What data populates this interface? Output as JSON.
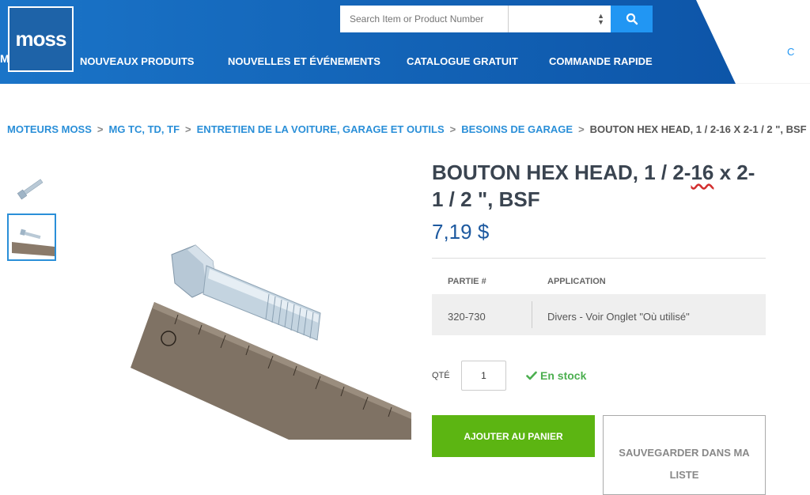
{
  "brand": {
    "logo_text": "moss",
    "clipped_nav_letter": "M"
  },
  "colors": {
    "header_blue": "#1565c0",
    "link_blue": "#2a8fd8",
    "price_blue": "#1e5aa0",
    "green": "#5cb512",
    "search_button": "#2196f3"
  },
  "search": {
    "placeholder": "Search Item or Product Number",
    "selected_option": ""
  },
  "nav": {
    "items": [
      {
        "label": "NOUVEAUX PRODUITS"
      },
      {
        "label": "NOUVELLES ET ÉVÉNEMENTS"
      },
      {
        "label": "CATALOGUE GRATUIT"
      },
      {
        "label": "COMMANDE RAPIDE"
      }
    ],
    "right_clip": "C"
  },
  "breadcrumb": {
    "links": [
      "MOTEURS MOSS",
      "MG TC, TD, TF",
      "ENTRETIEN DE LA VOITURE, GARAGE ET OUTILS",
      "BESOINS DE GARAGE"
    ],
    "separator": ">",
    "current": "BOUTON HEX HEAD, 1 / 2-16 X 2-1 / 2 \", BSF"
  },
  "product": {
    "title_before": "BOUTON HEX HEAD, 1 / 2-",
    "title_flagged": "16",
    "title_after": " x 2-1 / 2 \", BSF",
    "price": "7,19 $",
    "table": {
      "headers": [
        "PARTIE #",
        "APPLICATION"
      ],
      "row": [
        "320-730",
        "Divers - Voir Onglet \"Où utilisé\""
      ]
    },
    "qty_label": "QTÉ",
    "qty_value": "1",
    "stock": "En stock",
    "add_to_cart": "AJOUTER AU PANIER",
    "save_to_list": "SAUVEGARDER DANS MA LISTE"
  },
  "icons": {
    "search": "search-icon",
    "check": "check-icon",
    "select_arrows": "updown-arrows-icon"
  }
}
